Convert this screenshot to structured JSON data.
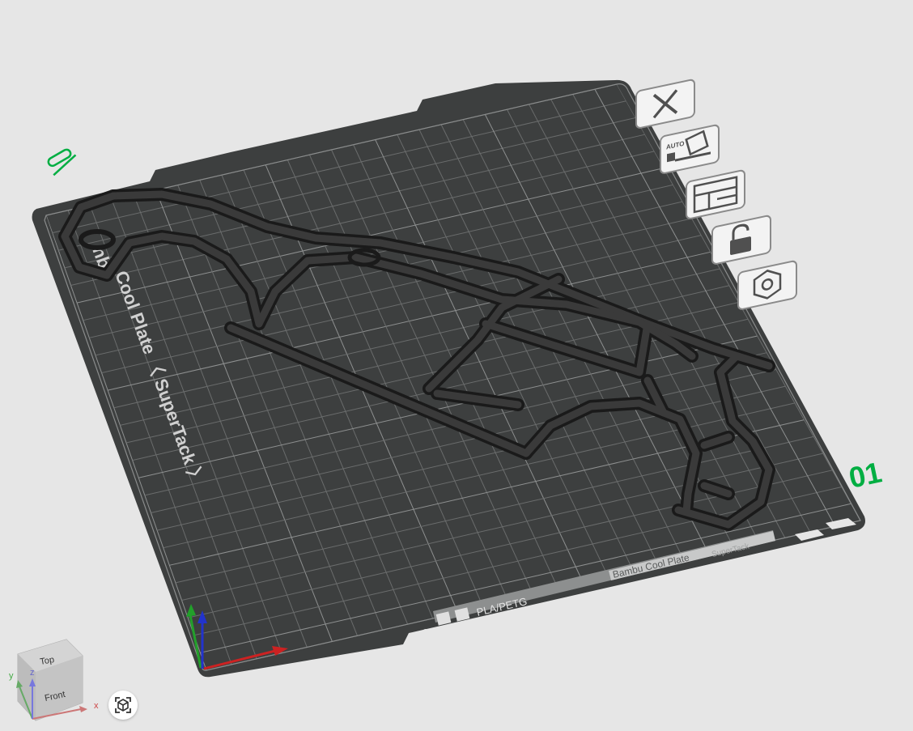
{
  "app": {
    "view": "3D Prepare view"
  },
  "plate": {
    "number": "01",
    "side_label": "Cool Plate 〈 SuperTack 〉",
    "side_label_prefix": "nb",
    "front_label_material": "PLA/PETG",
    "front_label_plate": "Bambu Cool Plate",
    "front_label_sub": "SuperTack"
  },
  "plate_toolbar": {
    "items": [
      {
        "name": "delete-plate",
        "icon": "close-icon"
      },
      {
        "name": "auto-orient",
        "icon": "auto-orient-icon",
        "label": "AUTO"
      },
      {
        "name": "arrange",
        "icon": "arrange-icon"
      },
      {
        "name": "lock",
        "icon": "lock-icon"
      },
      {
        "name": "plate-settings",
        "icon": "hex-nut-icon"
      }
    ]
  },
  "edit_name_icon": "pencil-icon",
  "nav_cube": {
    "top": "Top",
    "front": "Front",
    "axis_x": "x",
    "axis_y": "y",
    "axis_z": "z"
  },
  "colors": {
    "accent": "#00ae42",
    "plate": "#3d3f3f",
    "background": "#e6e6e6",
    "model": "#2b2b2b"
  }
}
